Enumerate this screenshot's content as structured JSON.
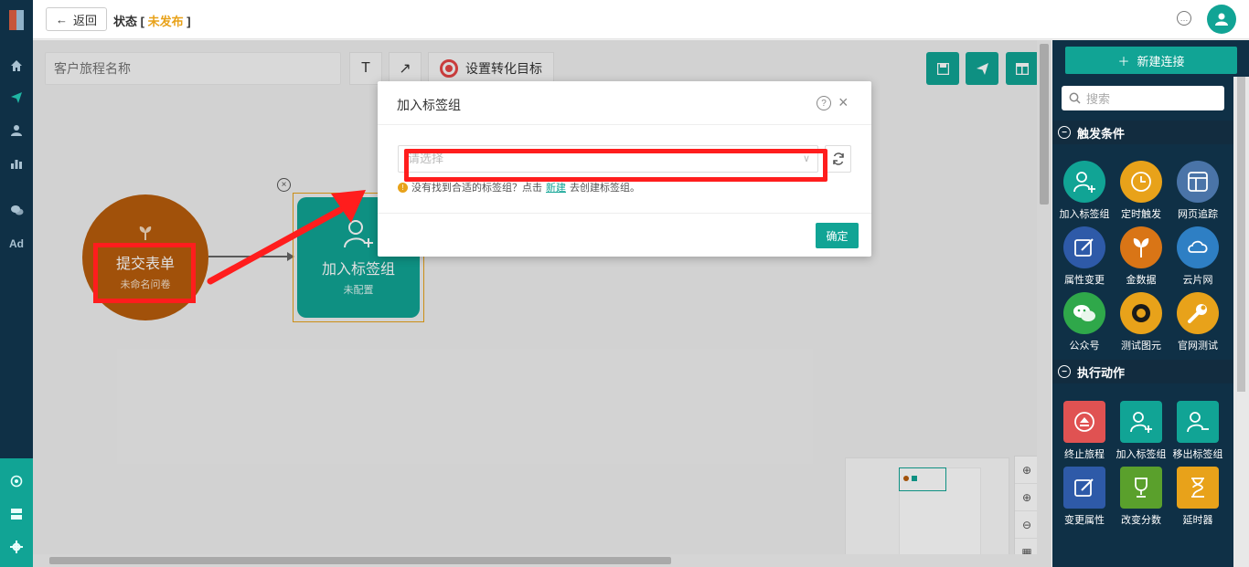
{
  "topbar": {
    "back_label": "返回",
    "status_label": "状态 [ ",
    "status_value": "未发布",
    "status_close": " ]"
  },
  "canvas": {
    "name_placeholder": "客户旅程名称",
    "text_tool": "T",
    "arrow_tool": "↗",
    "goal_label": "设置转化目标",
    "node_form": {
      "title": "提交表单",
      "subtitle": "未命名问卷"
    },
    "node_tag": {
      "title": "加入标签组",
      "subtitle": "未配置"
    },
    "close_node": "×"
  },
  "dialog": {
    "title": "加入标签组",
    "select_placeholder": "请选择",
    "hint_before": "没有找到合适的标签组？点击",
    "hint_link": "新建",
    "hint_after": "去创建标签组。",
    "ok_label": "确定"
  },
  "rightpanel": {
    "new_connection": "新建连接",
    "search_placeholder": "搜索",
    "sections": [
      {
        "title": "触发条件",
        "items": [
          {
            "label": "加入标签组",
            "color": "#11a495",
            "icon": "user-plus-icon"
          },
          {
            "label": "定时触发",
            "color": "#e8a21a",
            "icon": "clock-icon"
          },
          {
            "label": "网页追踪",
            "color": "#4a74a8",
            "icon": "webpage-icon"
          },
          {
            "label": "属性变更",
            "color": "#2e5aa8",
            "icon": "edit-icon"
          },
          {
            "label": "金数据",
            "color": "#d97516",
            "icon": "sprout-icon"
          },
          {
            "label": "云片网",
            "color": "#2e7fc4",
            "icon": "cloud-icon"
          },
          {
            "label": "公众号",
            "color": "#2fa84a",
            "icon": "wechat-icon"
          },
          {
            "label": "测试图元",
            "color": "#e8a21a",
            "icon": "test-icon"
          },
          {
            "label": "官网测试",
            "color": "#e8a21a",
            "icon": "wrench-icon"
          }
        ]
      },
      {
        "title": "执行动作",
        "items": [
          {
            "label": "终止旅程",
            "color": "#e05252",
            "icon": "eject-icon"
          },
          {
            "label": "加入标签组",
            "color": "#11a495",
            "icon": "user-plus-icon"
          },
          {
            "label": "移出标签组",
            "color": "#11a495",
            "icon": "user-minus-icon"
          },
          {
            "label": "变更属性",
            "color": "#2e5aa8",
            "icon": "edit-icon"
          },
          {
            "label": "改变分数",
            "color": "#5aa02c",
            "icon": "trophy-icon"
          },
          {
            "label": "延时器",
            "color": "#e8a21a",
            "icon": "hourglass-icon"
          }
        ]
      }
    ]
  }
}
